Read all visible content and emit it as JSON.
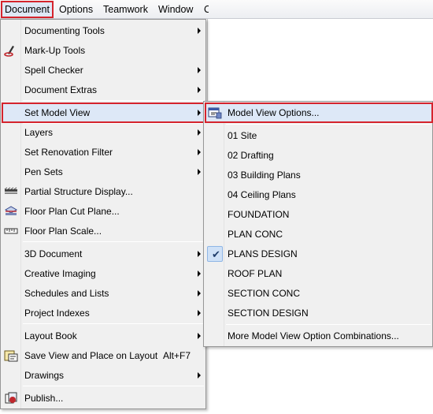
{
  "menubar": {
    "items": [
      {
        "name": "menubar-document",
        "label": "Document",
        "u": "D",
        "rest": "ocument"
      },
      {
        "name": "menubar-options",
        "label": "Options",
        "u": "O",
        "rest": "ptions"
      },
      {
        "name": "menubar-teamwork",
        "label": "Teamwork",
        "u": "T",
        "rest": "eamwork"
      },
      {
        "name": "menubar-window",
        "label": "Window",
        "u": "W",
        "rest": "indow"
      },
      {
        "name": "menubar-cut",
        "label": "C",
        "u": "C",
        "rest": ""
      }
    ]
  },
  "menu": {
    "items": [
      {
        "label": "Documenting Tools"
      },
      {
        "label": "Mark-Up Tools"
      },
      {
        "label": "Spell Checker"
      },
      {
        "label": "Document Extras"
      },
      {
        "label": "Set Model View"
      },
      {
        "label": "Layers"
      },
      {
        "label": "Set Renovation Filter"
      },
      {
        "label": "Pen Sets"
      },
      {
        "label": "Partial Structure Display..."
      },
      {
        "label": "Floor Plan Cut Plane..."
      },
      {
        "label": "Floor Plan Scale..."
      },
      {
        "label": "3D Document"
      },
      {
        "label": "Creative Imaging"
      },
      {
        "label": "Schedules and Lists"
      },
      {
        "label": "Project Indexes"
      },
      {
        "label": "Layout Book"
      },
      {
        "label": "Save View and Place on Layout",
        "shortcut": "Alt+F7"
      },
      {
        "label": "Drawings"
      },
      {
        "label": "Publish..."
      }
    ]
  },
  "submenu": {
    "items": [
      {
        "label": "Model View Options..."
      },
      {
        "label": "01 Site"
      },
      {
        "label": "02 Drafting"
      },
      {
        "label": "03 Building Plans"
      },
      {
        "label": "04 Ceiling Plans"
      },
      {
        "label": "FOUNDATION"
      },
      {
        "label": "PLAN CONC"
      },
      {
        "label": "PLANS DESIGN"
      },
      {
        "label": "ROOF PLAN"
      },
      {
        "label": "SECTION CONC"
      },
      {
        "label": "SECTION DESIGN"
      },
      {
        "label": "More Model View Option Combinations..."
      }
    ]
  },
  "colors": {
    "highlight_bg": "#dde8f7",
    "highlight_border": "#d5242d",
    "menu_bg": "#f0f0f0"
  }
}
